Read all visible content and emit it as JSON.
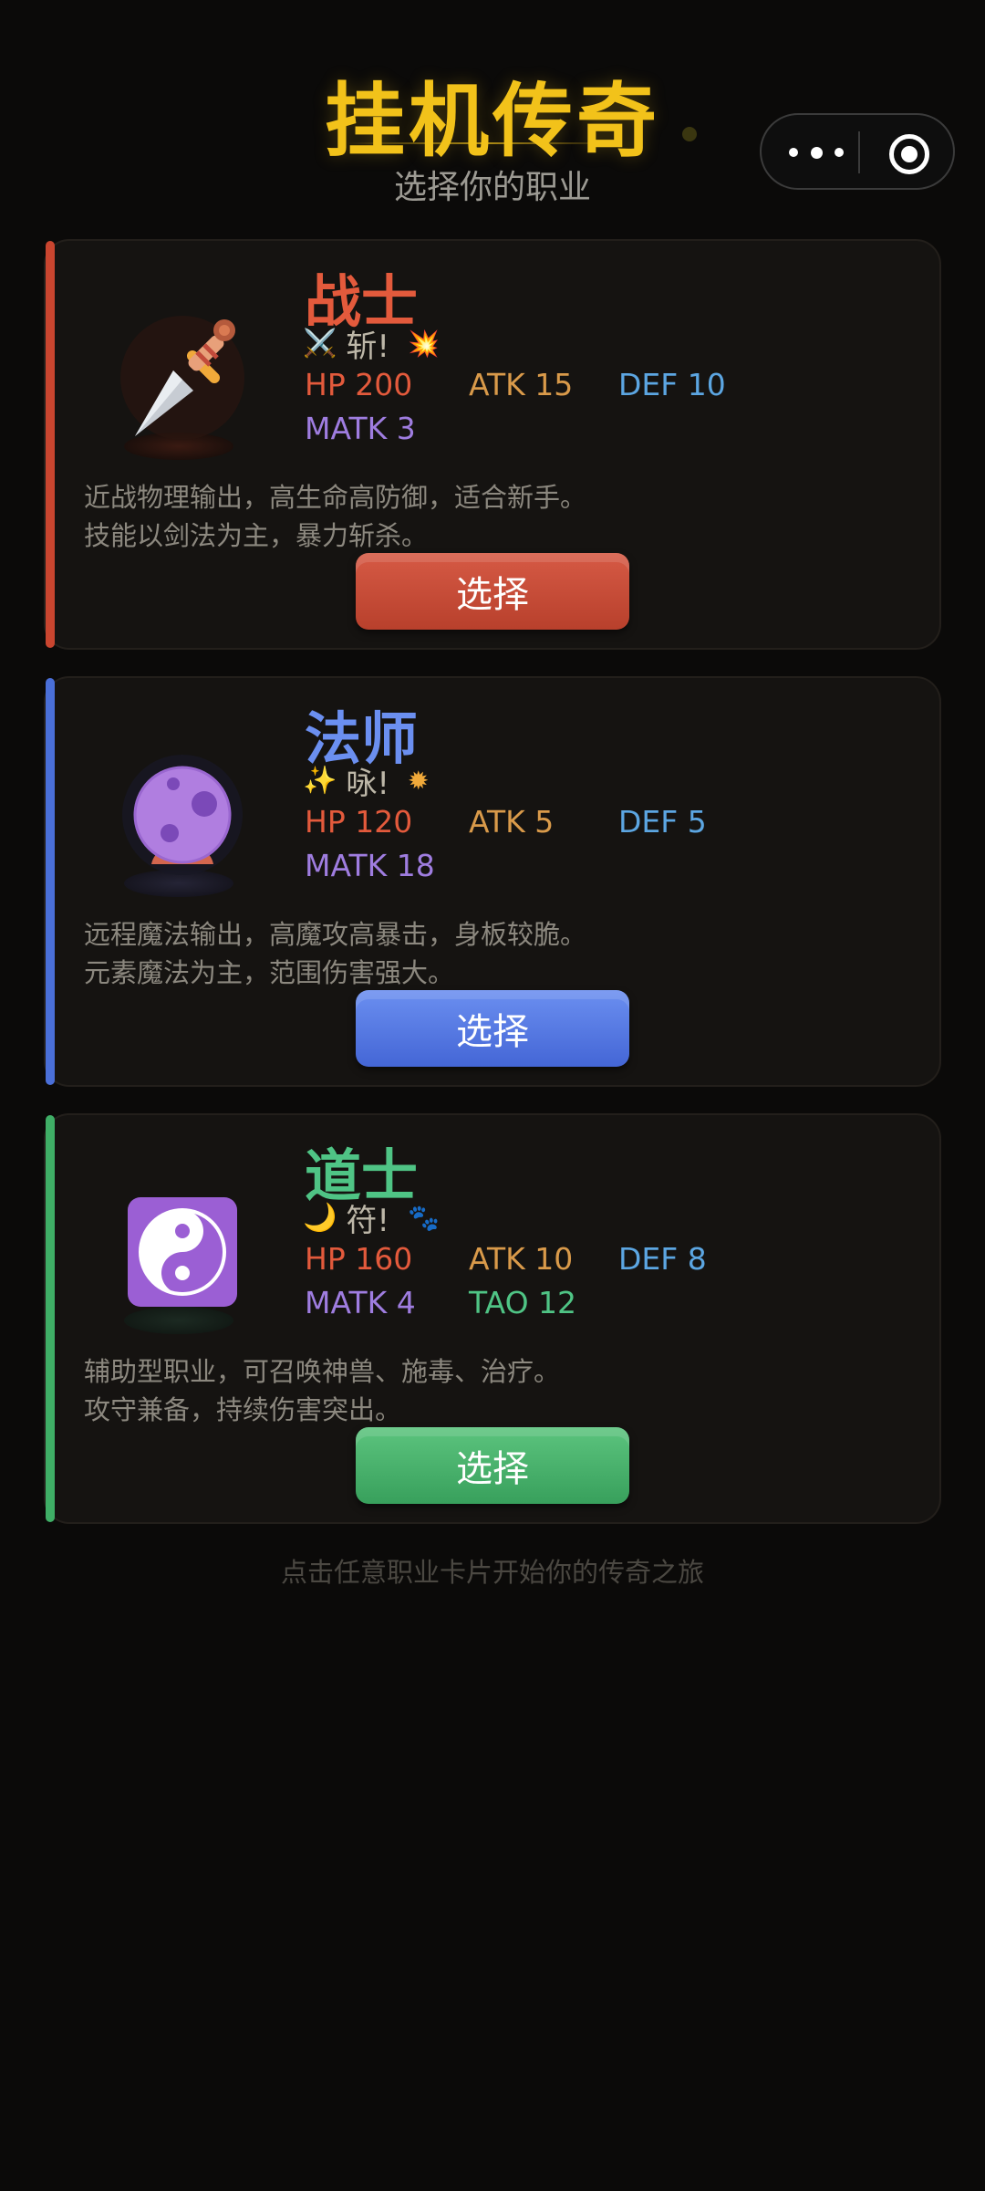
{
  "header": {
    "title": "挂机传奇",
    "subtitle": "选择你的职业",
    "menu_icon": "more-dots-icon",
    "close_icon": "target-circle-icon"
  },
  "classes": [
    {
      "name": "战士",
      "color": "#e35a3c",
      "icon": "dagger-icon",
      "action_emoji": "⚔️",
      "action_text": "斩!",
      "action_effect": "💥",
      "stats": {
        "hp": "HP 200",
        "atk": "ATK 15",
        "def": "DEF 10",
        "matk": "MATK 3"
      },
      "desc1": "近战物理输出，高生命高防御，适合新手。",
      "desc2": "技能以剑法为主，暴力斩杀。",
      "button": "选择",
      "button_color": "#c9452f"
    },
    {
      "name": "法师",
      "color": "#6b8ff0",
      "icon": "crystal-ball-icon",
      "action_emoji": "✨",
      "action_text": "咏!",
      "action_effect": "✹",
      "stats": {
        "hp": "HP 120",
        "atk": "ATK 5",
        "def": "DEF 5",
        "matk": "MATK 18"
      },
      "desc1": "远程魔法输出，高魔攻高暴击，身板较脆。",
      "desc2": "元素魔法为主，范围伤害强大。",
      "button": "选择",
      "button_color": "#4a6fd8"
    },
    {
      "name": "道士",
      "color": "#4fc485",
      "icon": "yin-yang-icon",
      "action_emoji": "🌙",
      "action_text": "符!",
      "action_effect": "🐾",
      "stats": {
        "hp": "HP 160",
        "atk": "ATK 10",
        "def": "DEF 8",
        "matk": "MATK 4",
        "tao": "TAO 12"
      },
      "desc1": "辅助型职业，可召唤神兽、施毒、治疗。",
      "desc2": "攻守兼备，持续伤害突出。",
      "button": "选择",
      "button_color": "#3fae66"
    }
  ],
  "footer_hint": "点击任意职业卡片开始你的传奇之旅"
}
